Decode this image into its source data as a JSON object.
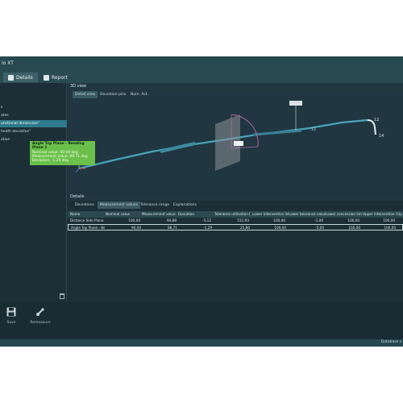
{
  "window": {
    "title": "io XT"
  },
  "tabs": [
    {
      "label": "Details",
      "active": true
    },
    {
      "label": "Report",
      "active": false
    }
  ],
  "tree": {
    "items": [
      {
        "label": "s",
        "selected": false
      },
      {
        "label": "ates",
        "selected": false
      },
      {
        "label": "unctional dimension\"",
        "selected": true
      },
      {
        "label": "heath deviation\"",
        "selected": false
      },
      {
        "label": "ation",
        "selected": false
      }
    ]
  },
  "bottom": {
    "save_label": "Save",
    "remeasure_label": "Remeasure"
  },
  "status": {
    "text": "Database s"
  },
  "view3d": {
    "title": "3D view",
    "tabs": [
      {
        "label": "Detail view",
        "active": true
      },
      {
        "label": "Deviation pins",
        "active": false
      },
      {
        "label": "Nom. Act.",
        "active": false
      }
    ],
    "labels": {
      "a": "12",
      "b": "14",
      "c": "13"
    },
    "tooltip": {
      "title": "Angle Top Plane - Bending Plane 1",
      "lines": [
        "Nominal value: 90.00 deg",
        "Measurement value: 88.71 deg",
        "Deviation: -1.29 deg"
      ]
    }
  },
  "details": {
    "title": "Details",
    "tabs": [
      {
        "label": "Deviations",
        "active": false
      },
      {
        "label": "Measurement values",
        "active": true
      },
      {
        "label": "Tolerance range",
        "active": false
      },
      {
        "label": "Explanations",
        "active": false
      }
    ],
    "columns": [
      "Name",
      "Nominal value",
      "Measurement value",
      "Deviation",
      "Tolerance utilisation [",
      "Lower intervention lim",
      "Lower tolerance value",
      "Lower concession lim",
      "Upper intervention lim",
      "Up"
    ],
    "rows": [
      {
        "cells": [
          "Distance Side Plane",
          "100,00",
          "94,88",
          "-5,12",
          "511,93",
          "100,00",
          "-1,00",
          "100,00",
          "100,00",
          ""
        ],
        "selected": false
      },
      {
        "cells": [
          "Angle Top Plane - Be",
          "90,00",
          "88,71",
          "-1,29",
          "25,80",
          "100,00",
          "-5,00",
          "100,00",
          "100,00",
          ""
        ],
        "selected": true
      }
    ]
  },
  "colors": {
    "selection": "#2e7a8c",
    "tooltip": "#6bbf4b",
    "pipe": "#4aa3b8",
    "plane": "#b06aa0"
  }
}
